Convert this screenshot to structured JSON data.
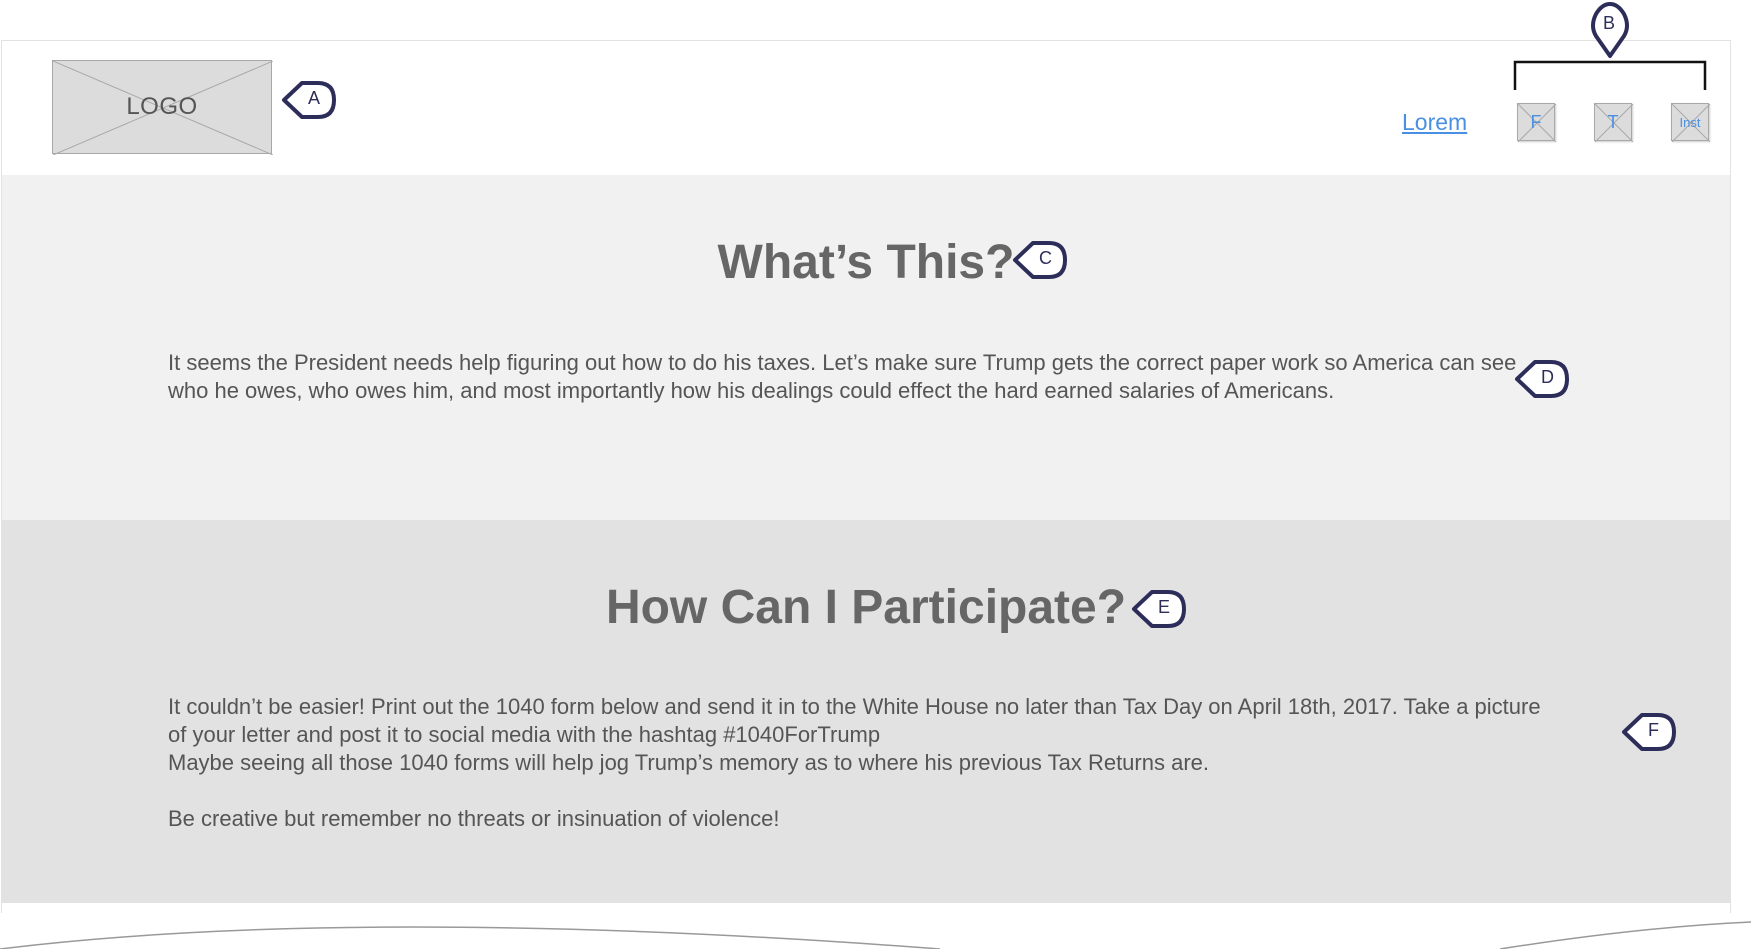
{
  "header": {
    "logo_text": "LOGO",
    "nav_link": "Lorem",
    "social": [
      {
        "label": "F",
        "icon": "facebook-icon"
      },
      {
        "label": "T",
        "icon": "twitter-icon"
      },
      {
        "label": "Inst",
        "icon": "instagram-icon"
      }
    ]
  },
  "section1": {
    "heading": "What’s This?",
    "body": "It seems the President needs help figuring out how to do his taxes.  Let’s make sure Trump gets the correct paper work so America can see who he owes, who owes him, and most importantly how his dealings could effect the hard earned salaries of Americans."
  },
  "section2": {
    "heading": "How Can I Participate?",
    "body_lines": [
      "It couldn’t be easier! Print out the 1040 form below and send it in to the White House no later than Tax Day on April 18th, 2017. Take a picture of your letter and post it to social media with the hashtag #1040ForTrump",
      "Maybe seeing all those 1040 forms will help jog Trump’s memory as to where his previous Tax Returns are.",
      "Be creative but remember no threats or insinuation of violence!"
    ]
  },
  "annotations": {
    "a": "A",
    "b": "B",
    "c": "C",
    "d": "D",
    "e": "E",
    "f": "F"
  },
  "colors": {
    "link": "#4a90e2",
    "marker": "#2d2d5a",
    "section1_bg": "#f1f1f1",
    "section2_bg": "#e2e2e2"
  }
}
